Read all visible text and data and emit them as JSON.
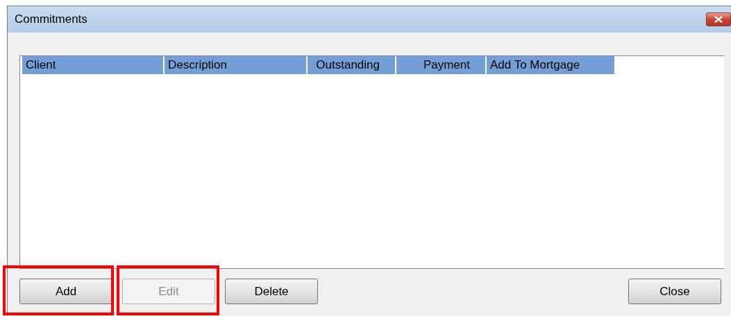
{
  "window": {
    "title": "Commitments"
  },
  "table": {
    "columns": [
      {
        "label": "Client"
      },
      {
        "label": "Description"
      },
      {
        "label": "Outstanding"
      },
      {
        "label": "Payment"
      },
      {
        "label": "Add To Mortgage"
      }
    ]
  },
  "buttons": [
    {
      "label": "Add",
      "disabled": false,
      "highlighted": true
    },
    {
      "label": "Edit",
      "disabled": true,
      "highlighted": true
    },
    {
      "label": "Delete",
      "disabled": false,
      "highlighted": false
    },
    {
      "label": "Close",
      "disabled": false,
      "highlighted": false
    }
  ]
}
